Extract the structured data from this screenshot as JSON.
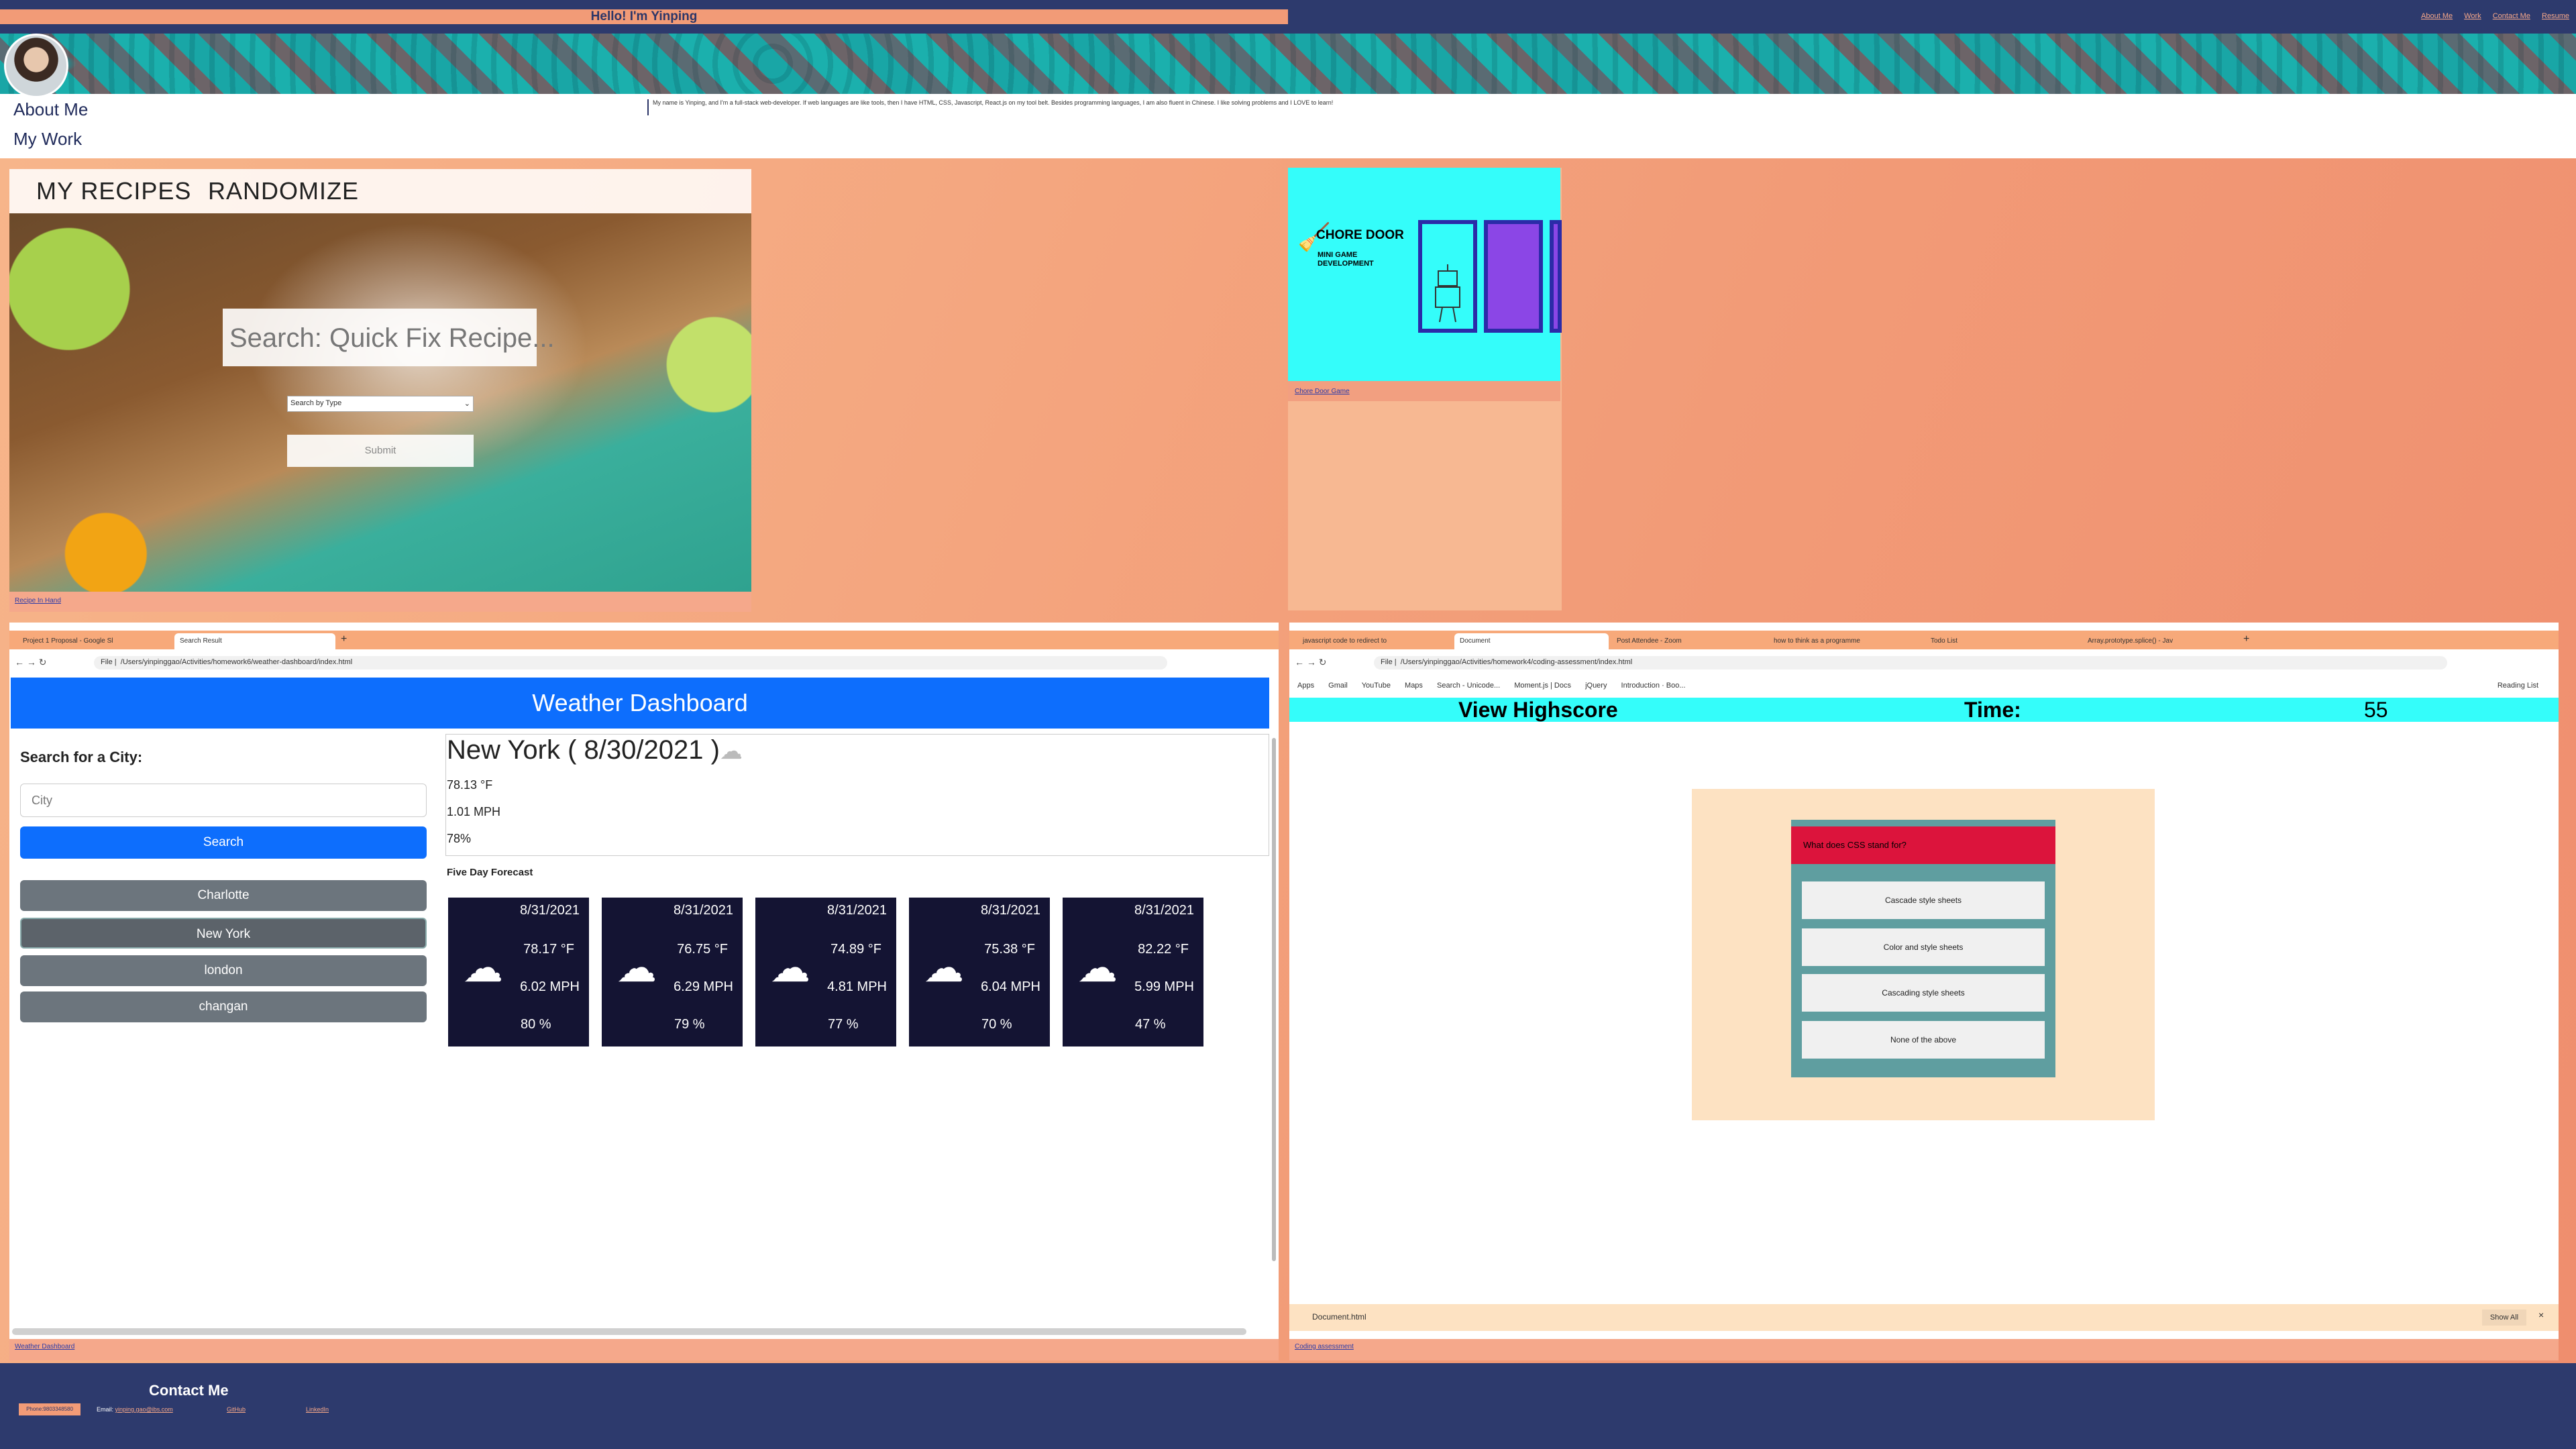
{
  "header": {
    "greeting": "Hello! I'm Yinping",
    "nav": [
      "About Me",
      "Work",
      "Contact Me",
      "Resume"
    ]
  },
  "about": {
    "nav_about": "About Me",
    "nav_work": "My Work",
    "bio": "My name is Yinping, and I'm a full-stack web-developer. If web languages are like tools, then I have HTML, CSS, Javascript, React.js on my tool belt. Besides programming languages, I am also fluent in Chinese. I like solving problems and I LOVE to learn!"
  },
  "recipe": {
    "tab_recipes": "MY RECIPES",
    "tab_randomize": "RANDOMIZE",
    "search_placeholder": "Search: Quick Fix Recipe...",
    "select_value": "Search by Type",
    "submit": "Submit",
    "link": "Recipe In Hand"
  },
  "chore": {
    "title": "CHORE DOOR",
    "subtitle": "MINI GAME DEVELOPMENT",
    "link": "Chore Door Game"
  },
  "weather_window": {
    "tabs": [
      "Project 1 Proposal - Google Sl",
      "Search Result"
    ],
    "url": "/Users/yinpinggao/Activities/homework6/weather-dashboard/index.html",
    "url_prefix": "File",
    "title": "Weather Dashboard",
    "search_label": "Search for a City:",
    "city_placeholder": "City",
    "search_button": "Search",
    "cities": [
      "Charlotte",
      "New York",
      "london",
      "changan"
    ],
    "current": {
      "title": "New York ( 8/30/2021 )",
      "temp": "78.13 °F",
      "wind": "1.01 MPH",
      "humidity": "78%"
    },
    "five_day_label": "Five Day Forecast",
    "forecast": [
      {
        "date": "8/31/2021",
        "temp": "78.17 °F",
        "wind": "6.02 MPH",
        "humidity": "80 %"
      },
      {
        "date": "8/31/2021",
        "temp": "76.75 °F",
        "wind": "6.29 MPH",
        "humidity": "79 %"
      },
      {
        "date": "8/31/2021",
        "temp": "74.89 °F",
        "wind": "4.81 MPH",
        "humidity": "77 %"
      },
      {
        "date": "8/31/2021",
        "temp": "75.38 °F",
        "wind": "6.04 MPH",
        "humidity": "70 %"
      },
      {
        "date": "8/31/2021",
        "temp": "82.22 °F",
        "wind": "5.99 MPH",
        "humidity": "47 %"
      }
    ],
    "link": "Weather Dashboard"
  },
  "quiz_window": {
    "tabs": [
      "javascript code to redirect to",
      "Document",
      "Post Attendee - Zoom",
      "how to think as a programme",
      "Todo List",
      "Array.prototype.splice() - Jav"
    ],
    "url": "/Users/yinpinggao/Activities/homework4/coding-assessment/index.html",
    "url_prefix": "File",
    "bookmarks": [
      "Apps",
      "Gmail",
      "YouTube",
      "Maps",
      "Search - Unicode...",
      "Moment.js | Docs",
      "jQuery",
      "Introduction · Boo...",
      "Reading List"
    ],
    "view_highscore": "View Highscore",
    "time_label": "Time:",
    "time_value": "55",
    "question": "What does CSS stand for?",
    "answers": [
      "Cascade style sheets",
      "Color and style sheets",
      "Cascading style sheets",
      "None of the above"
    ],
    "download_name": "Document.html",
    "show_all": "Show All",
    "link": "Coding assessment"
  },
  "footer": {
    "title": "Contact Me",
    "phone": "Phone:9803348580",
    "email_label": "Email:",
    "email": "yinping.gao@ibs.com",
    "github": "GitHub",
    "linkedin": "LinkedIn"
  }
}
